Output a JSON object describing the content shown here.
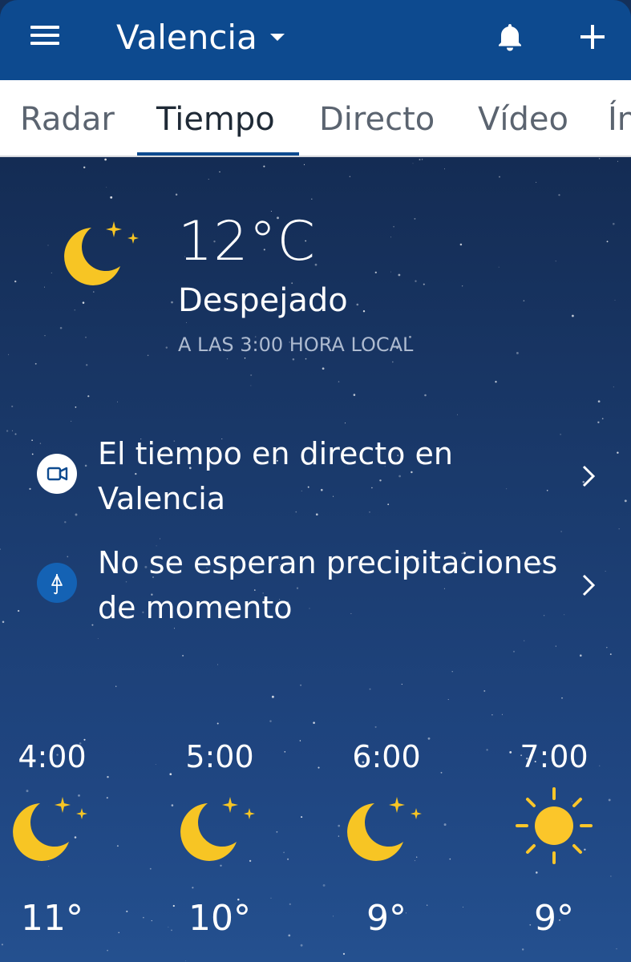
{
  "header": {
    "city": "Valencia",
    "icons": {
      "menu": "hamburger-menu-icon",
      "dropdown": "chevron-down-icon",
      "notifications": "bell-icon",
      "add": "plus-icon"
    }
  },
  "tabs": [
    {
      "label": "Radar",
      "active": false
    },
    {
      "label": "Tiempo",
      "active": true
    },
    {
      "label": "Directo",
      "active": false
    },
    {
      "label": "Vídeo",
      "active": false
    },
    {
      "label": "Ín",
      "active": false
    }
  ],
  "current": {
    "temperature": "12°C",
    "condition": "Despejado",
    "observed_at": "A LAS 3:00 HORA LOCAL",
    "icon": "moon-stars-icon"
  },
  "info_rows": [
    {
      "text": "El tiempo en directo en Valencia",
      "icon": "video-camera-icon"
    },
    {
      "text": "No se esperan precipitaciones de momento",
      "icon": "umbrella-icon"
    }
  ],
  "hourly": [
    {
      "time": "4:00",
      "temp": "11°",
      "icon": "moon-stars-icon"
    },
    {
      "time": "5:00",
      "temp": "10°",
      "icon": "moon-stars-icon"
    },
    {
      "time": "6:00",
      "temp": "9°",
      "icon": "moon-stars-icon"
    },
    {
      "time": "7:00",
      "temp": "9°",
      "icon": "sun-icon"
    }
  ],
  "colors": {
    "header_bg": "#0d4a8f",
    "tab_indicator": "#0d4a8f",
    "sky_top": "#142c54",
    "sky_bottom": "#24508f",
    "moon_yellow": "#f7c524",
    "sun_yellow": "#fbc62a"
  }
}
